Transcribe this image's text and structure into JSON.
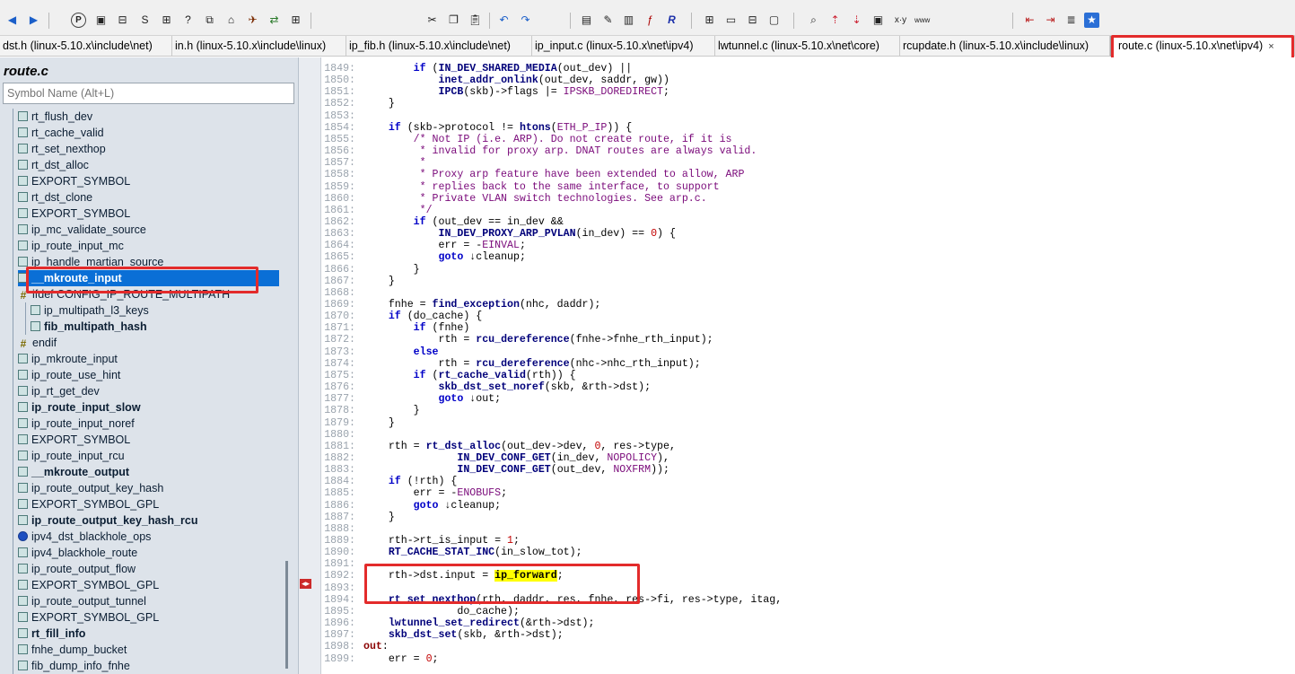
{
  "tabs": [
    {
      "label": "dst.h (linux-5.10.x\\include\\net)"
    },
    {
      "label": "in.h (linux-5.10.x\\include\\linux)"
    },
    {
      "label": "ip_fib.h (linux-5.10.x\\include\\net)"
    },
    {
      "label": "ip_input.c (linux-5.10.x\\net\\ipv4)"
    },
    {
      "label": "lwtunnel.c (linux-5.10.x\\net\\core)"
    },
    {
      "label": "rcupdate.h (linux-5.10.x\\include\\linux)"
    },
    {
      "label": "route.c (linux-5.10.x\\net\\ipv4)",
      "close": "×"
    }
  ],
  "sidebar": {
    "file_title": "route.c",
    "search_placeholder": "Symbol Name (Alt+L)",
    "symbols": [
      {
        "label": "rt_flush_dev",
        "bold": false,
        "icon": "func-icon"
      },
      {
        "label": "rt_cache_valid",
        "bold": false,
        "icon": "func-icon"
      },
      {
        "label": "rt_set_nexthop",
        "bold": false,
        "icon": "func-icon"
      },
      {
        "label": "rt_dst_alloc",
        "bold": false,
        "icon": "func-icon"
      },
      {
        "label": "EXPORT_SYMBOL",
        "bold": false,
        "icon": "func-icon"
      },
      {
        "label": "rt_dst_clone",
        "bold": false,
        "icon": "func-icon"
      },
      {
        "label": "EXPORT_SYMBOL",
        "bold": false,
        "icon": "func-icon"
      },
      {
        "label": "ip_mc_validate_source",
        "bold": false,
        "icon": "func-icon"
      },
      {
        "label": "ip_route_input_mc",
        "bold": false,
        "icon": "func-icon"
      },
      {
        "label": "ip_handle_martian_source",
        "bold": false,
        "icon": "func-icon"
      },
      {
        "label": "__mkroute_input",
        "bold": true,
        "icon": "func-icon",
        "selected": true
      },
      {
        "label": "ifdef CONFIG_IP_ROUTE_MULTIPATH",
        "bold": false,
        "icon": "hash-icon"
      },
      {
        "label": "ip_multipath_l3_keys",
        "bold": false,
        "icon": "func-icon",
        "indent": true
      },
      {
        "label": "fib_multipath_hash",
        "bold": true,
        "icon": "func-icon",
        "indent": true
      },
      {
        "label": "endif",
        "bold": false,
        "icon": "hash-icon"
      },
      {
        "label": "ip_mkroute_input",
        "bold": false,
        "icon": "func-icon"
      },
      {
        "label": "ip_route_use_hint",
        "bold": false,
        "icon": "func-icon"
      },
      {
        "label": "ip_rt_get_dev",
        "bold": false,
        "icon": "func-icon"
      },
      {
        "label": "ip_route_input_slow",
        "bold": true,
        "icon": "func-icon"
      },
      {
        "label": "ip_route_input_noref",
        "bold": false,
        "icon": "func-icon"
      },
      {
        "label": "EXPORT_SYMBOL",
        "bold": false,
        "icon": "func-icon"
      },
      {
        "label": "ip_route_input_rcu",
        "bold": false,
        "icon": "func-icon"
      },
      {
        "label": "__mkroute_output",
        "bold": true,
        "icon": "func-icon"
      },
      {
        "label": "ip_route_output_key_hash",
        "bold": false,
        "icon": "func-icon"
      },
      {
        "label": "EXPORT_SYMBOL_GPL",
        "bold": false,
        "icon": "func-icon"
      },
      {
        "label": "ip_route_output_key_hash_rcu",
        "bold": true,
        "icon": "func-icon"
      },
      {
        "label": "ipv4_dst_blackhole_ops",
        "bold": false,
        "icon": "struct-icon"
      },
      {
        "label": "ipv4_blackhole_route",
        "bold": false,
        "icon": "func-icon"
      },
      {
        "label": "ip_route_output_flow",
        "bold": false,
        "icon": "func-icon"
      },
      {
        "label": "EXPORT_SYMBOL_GPL",
        "bold": false,
        "icon": "func-icon"
      },
      {
        "label": "ip_route_output_tunnel",
        "bold": false,
        "icon": "func-icon"
      },
      {
        "label": "EXPORT_SYMBOL_GPL",
        "bold": false,
        "icon": "func-icon"
      },
      {
        "label": "rt_fill_info",
        "bold": true,
        "icon": "func-icon"
      },
      {
        "label": "fnhe_dump_bucket",
        "bold": false,
        "icon": "func-icon"
      },
      {
        "label": "fib_dump_info_fnhe",
        "bold": false,
        "icon": "func-icon"
      }
    ]
  },
  "code": {
    "lines": [
      {
        "n": "1849:",
        "t": "        if (IN_DEV_SHARED_MEDIA(out_dev) ||"
      },
      {
        "n": "1850:",
        "t": "            inet_addr_onlink(out_dev, saddr, gw))"
      },
      {
        "n": "1851:",
        "t": "            IPCB(skb)->flags |= IPSKB_DOREDIRECT;"
      },
      {
        "n": "1852:",
        "t": "    }"
      },
      {
        "n": "1853:",
        "t": ""
      },
      {
        "n": "1854:",
        "t": "    if (skb->protocol != htons(ETH_P_IP)) {"
      },
      {
        "n": "1855:",
        "t": "        /* Not IP (i.e. ARP). Do not create route, if it is"
      },
      {
        "n": "1856:",
        "t": "         * invalid for proxy arp. DNAT routes are always valid."
      },
      {
        "n": "1857:",
        "t": "         *"
      },
      {
        "n": "1858:",
        "t": "         * Proxy arp feature have been extended to allow, ARP"
      },
      {
        "n": "1859:",
        "t": "         * replies back to the same interface, to support"
      },
      {
        "n": "1860:",
        "t": "         * Private VLAN switch technologies. See arp.c."
      },
      {
        "n": "1861:",
        "t": "         */"
      },
      {
        "n": "1862:",
        "t": "        if (out_dev == in_dev &&"
      },
      {
        "n": "1863:",
        "t": "            IN_DEV_PROXY_ARP_PVLAN(in_dev) == 0) {"
      },
      {
        "n": "1864:",
        "t": "            err = -EINVAL;"
      },
      {
        "n": "1865:",
        "t": "            goto ↓cleanup;"
      },
      {
        "n": "1866:",
        "t": "        }"
      },
      {
        "n": "1867:",
        "t": "    }"
      },
      {
        "n": "1868:",
        "t": ""
      },
      {
        "n": "1869:",
        "t": "    fnhe = find_exception(nhc, daddr);"
      },
      {
        "n": "1870:",
        "t": "    if (do_cache) {"
      },
      {
        "n": "1871:",
        "t": "        if (fnhe)"
      },
      {
        "n": "1872:",
        "t": "            rth = rcu_dereference(fnhe->fnhe_rth_input);"
      },
      {
        "n": "1873:",
        "t": "        else"
      },
      {
        "n": "1874:",
        "t": "            rth = rcu_dereference(nhc->nhc_rth_input);"
      },
      {
        "n": "1875:",
        "t": "        if (rt_cache_valid(rth)) {"
      },
      {
        "n": "1876:",
        "t": "            skb_dst_set_noref(skb, &rth->dst);"
      },
      {
        "n": "1877:",
        "t": "            goto ↓out;"
      },
      {
        "n": "1878:",
        "t": "        }"
      },
      {
        "n": "1879:",
        "t": "    }"
      },
      {
        "n": "1880:",
        "t": ""
      },
      {
        "n": "1881:",
        "t": "    rth = rt_dst_alloc(out_dev->dev, 0, res->type,"
      },
      {
        "n": "1882:",
        "t": "               IN_DEV_CONF_GET(in_dev, NOPOLICY),"
      },
      {
        "n": "1883:",
        "t": "               IN_DEV_CONF_GET(out_dev, NOXFRM));"
      },
      {
        "n": "1884:",
        "t": "    if (!rth) {"
      },
      {
        "n": "1885:",
        "t": "        err = -ENOBUFS;"
      },
      {
        "n": "1886:",
        "t": "        goto ↓cleanup;"
      },
      {
        "n": "1887:",
        "t": "    }"
      },
      {
        "n": "1888:",
        "t": ""
      },
      {
        "n": "1889:",
        "t": "    rth->rt_is_input = 1;"
      },
      {
        "n": "1890:",
        "t": "    RT_CACHE_STAT_INC(in_slow_tot);"
      },
      {
        "n": "1891:",
        "t": ""
      },
      {
        "n": "1892:",
        "t": "    rth->dst.input = ",
        "hl": "ip_forward",
        "tail": ";"
      },
      {
        "n": "1893:",
        "t": ""
      },
      {
        "n": "1894:",
        "t": "    rt_set_nexthop(rth, daddr, res, fnhe, res->fi, res->type, itag,"
      },
      {
        "n": "1895:",
        "t": "               do_cache);"
      },
      {
        "n": "1896:",
        "t": "    lwtunnel_set_redirect(&rth->dst);"
      },
      {
        "n": "1897:",
        "t": "    skb_dst_set(skb, &rth->dst);"
      },
      {
        "n": "1898:",
        "t": "out:"
      },
      {
        "n": "1899:",
        "t": "    err = 0;"
      }
    ]
  },
  "colors": {
    "accent_selection": "#0a6fd6",
    "annotation_red": "#e32b2b",
    "highlight": "#ffff00"
  }
}
